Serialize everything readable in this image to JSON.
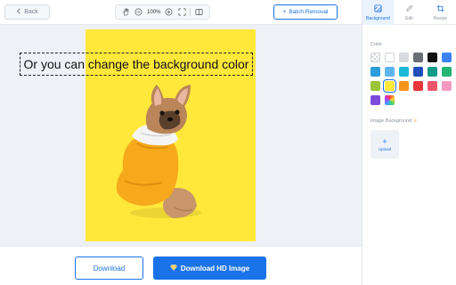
{
  "toolbar": {
    "back_label": "Back",
    "zoom_level": "100%",
    "batch_label": "Batch Removal",
    "icons": [
      "hand-icon",
      "zoom-out-icon",
      "zoom-in-icon",
      "fit-screen-icon",
      "compare-icon"
    ]
  },
  "canvas": {
    "overlay_text": "Or you can change the background color",
    "background_color": "#ffe83a",
    "subject": "french-bulldog-in-yellow-hoodie"
  },
  "bottom": {
    "download_label": "Download",
    "hd_label": "Download HD Image"
  },
  "panel": {
    "tabs": [
      {
        "label": "Background",
        "icon": "background-icon",
        "active": true
      },
      {
        "label": "Edit",
        "icon": "edit-icon",
        "active": false
      },
      {
        "label": "Resize",
        "icon": "crop-icon",
        "active": false
      }
    ],
    "color_label": "Color",
    "colors": [
      {
        "name": "transparent",
        "hex": "transparent"
      },
      {
        "name": "white",
        "hex": "#ffffff"
      },
      {
        "name": "light-gray",
        "hex": "#d9dbe0"
      },
      {
        "name": "dark-gray",
        "hex": "#6b6f76"
      },
      {
        "name": "black",
        "hex": "#111111"
      },
      {
        "name": "blue",
        "hex": "#3b82f6"
      },
      {
        "name": "sky-blue",
        "hex": "#2d9cdb"
      },
      {
        "name": "light-blue",
        "hex": "#5fb4f0"
      },
      {
        "name": "cyan",
        "hex": "#1cb8d6"
      },
      {
        "name": "navy",
        "hex": "#1f4fb8"
      },
      {
        "name": "teal",
        "hex": "#0f9b86"
      },
      {
        "name": "green",
        "hex": "#22b573"
      },
      {
        "name": "lime",
        "hex": "#9bc43a"
      },
      {
        "name": "yellow",
        "hex": "#ffe83a",
        "selected": true
      },
      {
        "name": "orange",
        "hex": "#f7941d"
      },
      {
        "name": "red",
        "hex": "#e8363b"
      },
      {
        "name": "coral",
        "hex": "#f0566a"
      },
      {
        "name": "pink",
        "hex": "#f49ac1"
      },
      {
        "name": "purple",
        "hex": "#7b4bd9"
      },
      {
        "name": "gradient",
        "hex": "rainbow"
      }
    ],
    "image_background_label": "Image Background",
    "upload_label": "Upload"
  }
}
